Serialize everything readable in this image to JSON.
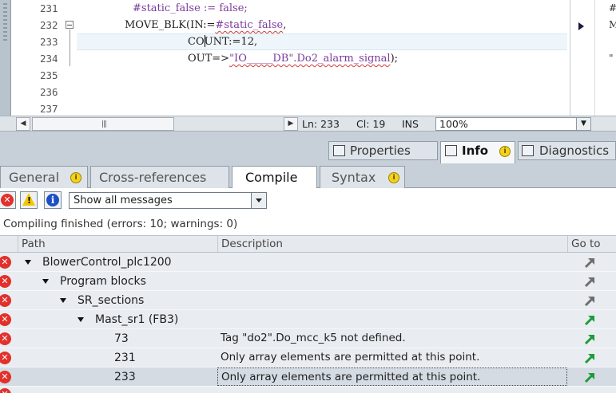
{
  "editor": {
    "lines": [
      {
        "num": "231",
        "code": "#static_false := false;"
      },
      {
        "num": "232",
        "code_prefix": "MOVE_BLK(IN:=",
        "code_var": "#static_false",
        "code_suffix": ","
      },
      {
        "num": "233",
        "code_a": "CO",
        "code_b": "UNT:=12,"
      },
      {
        "num": "234",
        "code_a": "OUT=>",
        "code_var": "\"IO_____DB\".Do2_alarm_signal",
        "code_b": ");"
      },
      {
        "num": "235"
      },
      {
        "num": "236"
      },
      {
        "num": "237"
      }
    ],
    "side_text": [
      "#",
      "M",
      "\""
    ]
  },
  "status": {
    "ln": "Ln: 233",
    "cl": "Cl: 19",
    "mode": "INS",
    "zoom": "100%"
  },
  "inspector": {
    "properties": "Properties",
    "info": "Info",
    "diagnostics": "Diagnostics"
  },
  "subtabs": {
    "general": "General",
    "crossref": "Cross-references",
    "compile": "Compile",
    "syntax": "Syntax"
  },
  "filter": {
    "selected": "Show all messages"
  },
  "compile_summary": "Compiling finished (errors: 10; warnings: 0)",
  "table": {
    "headers": [
      "Path",
      "Description",
      "Go to"
    ],
    "rows": [
      {
        "path": "BlowerControl_plc1200",
        "desc": "",
        "goto": "grey"
      },
      {
        "path": "Program blocks",
        "desc": "",
        "goto": "grey"
      },
      {
        "path": "SR_sections",
        "desc": "",
        "goto": "grey"
      },
      {
        "path": "Mast_sr1 (FB3)",
        "desc": "",
        "goto": "green"
      },
      {
        "path": "73",
        "desc": "Tag \"do2\".Do_mcc_k5 not defined.",
        "goto": "green"
      },
      {
        "path": "231",
        "desc": "Only array elements are permitted at this point.",
        "goto": "green"
      },
      {
        "path": "233",
        "desc": "Only array elements are permitted at this point.",
        "goto": "green"
      }
    ]
  },
  "colors": {
    "error": "#e2302a",
    "goto_green": "#1f9a3a",
    "goto_grey": "#6e6e6e"
  }
}
